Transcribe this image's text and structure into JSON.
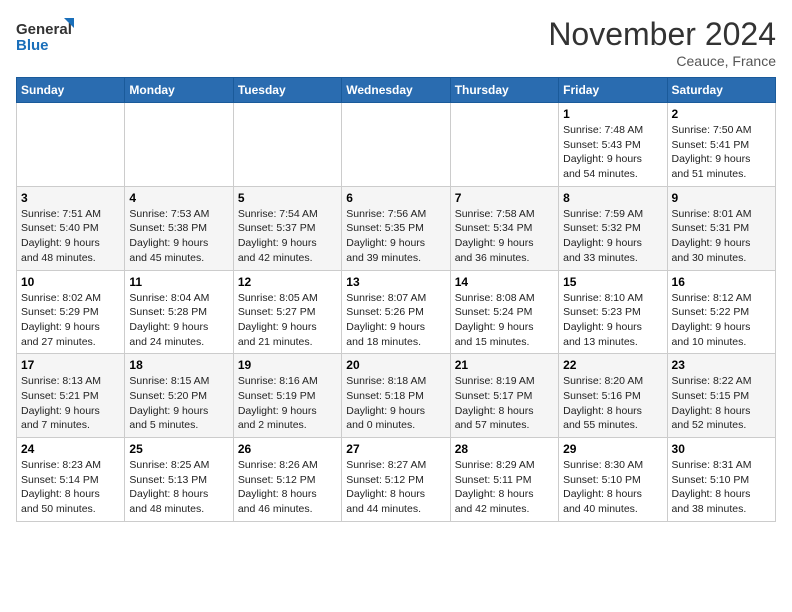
{
  "header": {
    "logo_line1": "General",
    "logo_line2": "Blue",
    "month_title": "November 2024",
    "location": "Ceauce, France"
  },
  "weekdays": [
    "Sunday",
    "Monday",
    "Tuesday",
    "Wednesday",
    "Thursday",
    "Friday",
    "Saturday"
  ],
  "weeks": [
    [
      {
        "day": "",
        "info": ""
      },
      {
        "day": "",
        "info": ""
      },
      {
        "day": "",
        "info": ""
      },
      {
        "day": "",
        "info": ""
      },
      {
        "day": "",
        "info": ""
      },
      {
        "day": "1",
        "info": "Sunrise: 7:48 AM\nSunset: 5:43 PM\nDaylight: 9 hours\nand 54 minutes."
      },
      {
        "day": "2",
        "info": "Sunrise: 7:50 AM\nSunset: 5:41 PM\nDaylight: 9 hours\nand 51 minutes."
      }
    ],
    [
      {
        "day": "3",
        "info": "Sunrise: 7:51 AM\nSunset: 5:40 PM\nDaylight: 9 hours\nand 48 minutes."
      },
      {
        "day": "4",
        "info": "Sunrise: 7:53 AM\nSunset: 5:38 PM\nDaylight: 9 hours\nand 45 minutes."
      },
      {
        "day": "5",
        "info": "Sunrise: 7:54 AM\nSunset: 5:37 PM\nDaylight: 9 hours\nand 42 minutes."
      },
      {
        "day": "6",
        "info": "Sunrise: 7:56 AM\nSunset: 5:35 PM\nDaylight: 9 hours\nand 39 minutes."
      },
      {
        "day": "7",
        "info": "Sunrise: 7:58 AM\nSunset: 5:34 PM\nDaylight: 9 hours\nand 36 minutes."
      },
      {
        "day": "8",
        "info": "Sunrise: 7:59 AM\nSunset: 5:32 PM\nDaylight: 9 hours\nand 33 minutes."
      },
      {
        "day": "9",
        "info": "Sunrise: 8:01 AM\nSunset: 5:31 PM\nDaylight: 9 hours\nand 30 minutes."
      }
    ],
    [
      {
        "day": "10",
        "info": "Sunrise: 8:02 AM\nSunset: 5:29 PM\nDaylight: 9 hours\nand 27 minutes."
      },
      {
        "day": "11",
        "info": "Sunrise: 8:04 AM\nSunset: 5:28 PM\nDaylight: 9 hours\nand 24 minutes."
      },
      {
        "day": "12",
        "info": "Sunrise: 8:05 AM\nSunset: 5:27 PM\nDaylight: 9 hours\nand 21 minutes."
      },
      {
        "day": "13",
        "info": "Sunrise: 8:07 AM\nSunset: 5:26 PM\nDaylight: 9 hours\nand 18 minutes."
      },
      {
        "day": "14",
        "info": "Sunrise: 8:08 AM\nSunset: 5:24 PM\nDaylight: 9 hours\nand 15 minutes."
      },
      {
        "day": "15",
        "info": "Sunrise: 8:10 AM\nSunset: 5:23 PM\nDaylight: 9 hours\nand 13 minutes."
      },
      {
        "day": "16",
        "info": "Sunrise: 8:12 AM\nSunset: 5:22 PM\nDaylight: 9 hours\nand 10 minutes."
      }
    ],
    [
      {
        "day": "17",
        "info": "Sunrise: 8:13 AM\nSunset: 5:21 PM\nDaylight: 9 hours\nand 7 minutes."
      },
      {
        "day": "18",
        "info": "Sunrise: 8:15 AM\nSunset: 5:20 PM\nDaylight: 9 hours\nand 5 minutes."
      },
      {
        "day": "19",
        "info": "Sunrise: 8:16 AM\nSunset: 5:19 PM\nDaylight: 9 hours\nand 2 minutes."
      },
      {
        "day": "20",
        "info": "Sunrise: 8:18 AM\nSunset: 5:18 PM\nDaylight: 9 hours\nand 0 minutes."
      },
      {
        "day": "21",
        "info": "Sunrise: 8:19 AM\nSunset: 5:17 PM\nDaylight: 8 hours\nand 57 minutes."
      },
      {
        "day": "22",
        "info": "Sunrise: 8:20 AM\nSunset: 5:16 PM\nDaylight: 8 hours\nand 55 minutes."
      },
      {
        "day": "23",
        "info": "Sunrise: 8:22 AM\nSunset: 5:15 PM\nDaylight: 8 hours\nand 52 minutes."
      }
    ],
    [
      {
        "day": "24",
        "info": "Sunrise: 8:23 AM\nSunset: 5:14 PM\nDaylight: 8 hours\nand 50 minutes."
      },
      {
        "day": "25",
        "info": "Sunrise: 8:25 AM\nSunset: 5:13 PM\nDaylight: 8 hours\nand 48 minutes."
      },
      {
        "day": "26",
        "info": "Sunrise: 8:26 AM\nSunset: 5:12 PM\nDaylight: 8 hours\nand 46 minutes."
      },
      {
        "day": "27",
        "info": "Sunrise: 8:27 AM\nSunset: 5:12 PM\nDaylight: 8 hours\nand 44 minutes."
      },
      {
        "day": "28",
        "info": "Sunrise: 8:29 AM\nSunset: 5:11 PM\nDaylight: 8 hours\nand 42 minutes."
      },
      {
        "day": "29",
        "info": "Sunrise: 8:30 AM\nSunset: 5:10 PM\nDaylight: 8 hours\nand 40 minutes."
      },
      {
        "day": "30",
        "info": "Sunrise: 8:31 AM\nSunset: 5:10 PM\nDaylight: 8 hours\nand 38 minutes."
      }
    ]
  ]
}
